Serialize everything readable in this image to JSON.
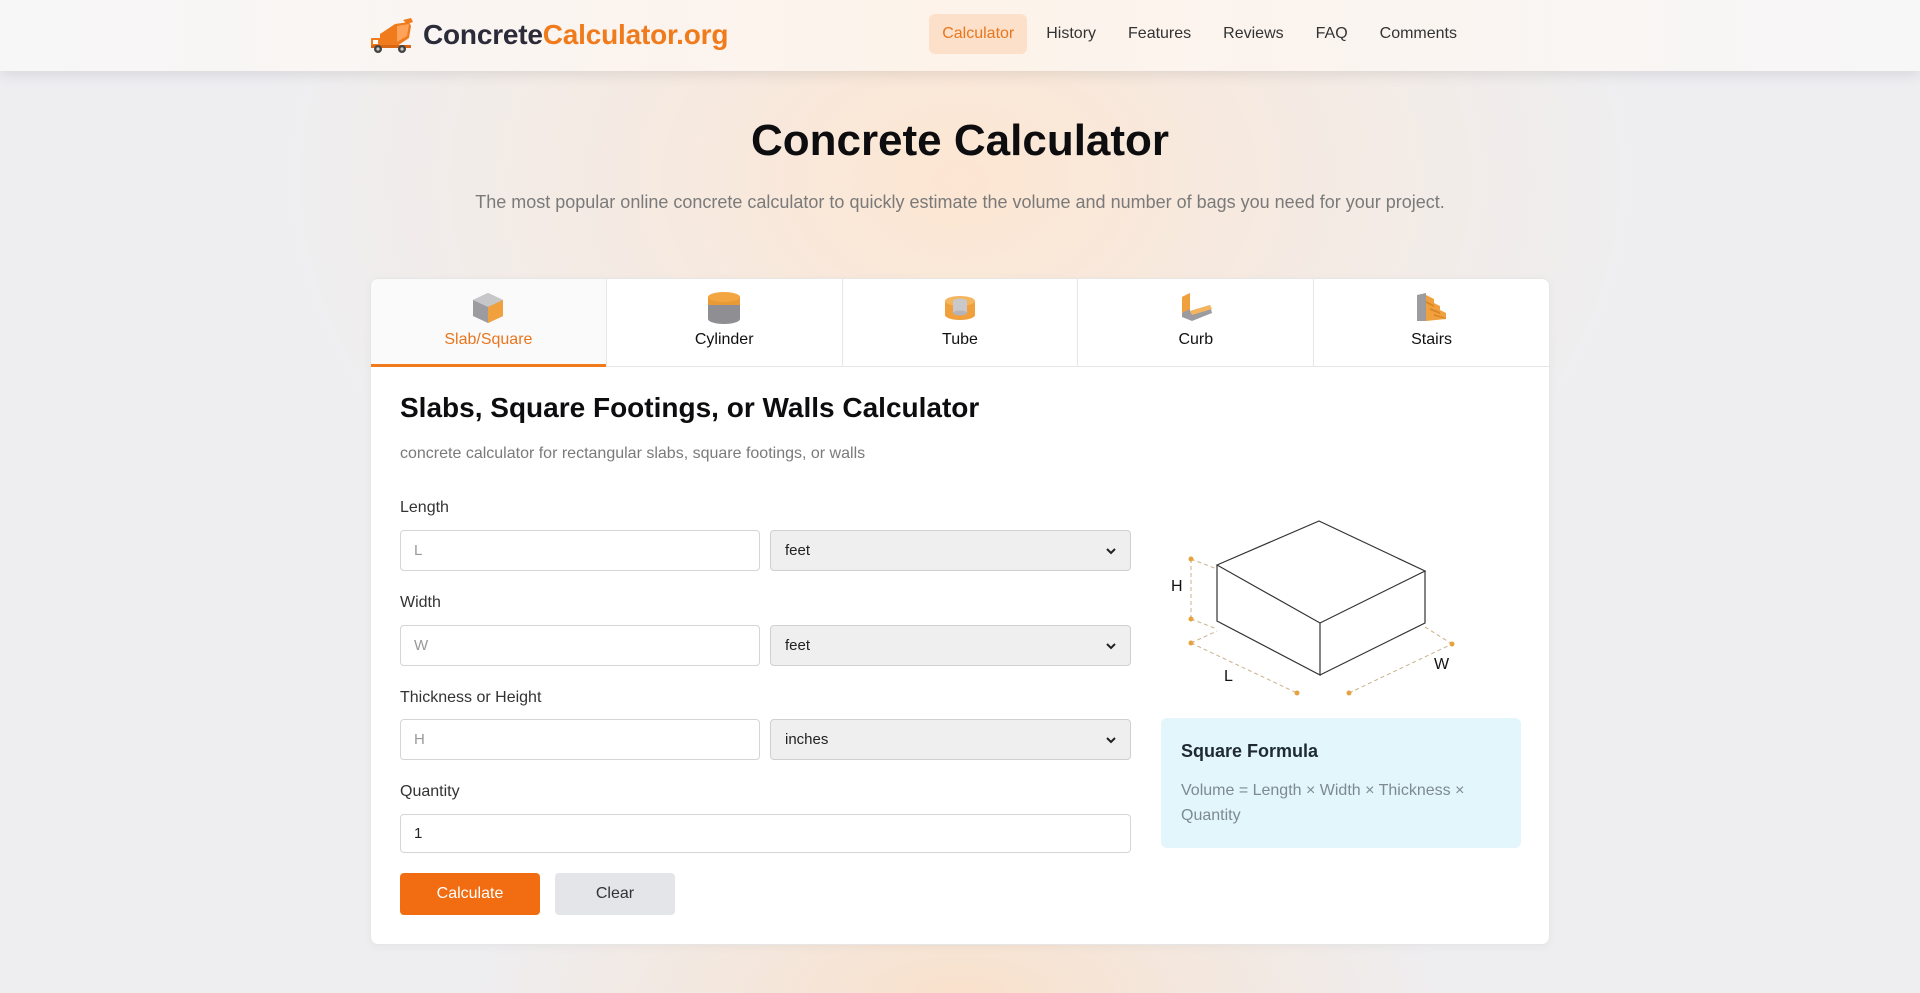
{
  "header": {
    "logo_part1": "Concrete",
    "logo_part2": "Calculator.org",
    "logo_icon": "concrete-mixer-truck-icon",
    "nav": [
      {
        "label": "Calculator",
        "active": true
      },
      {
        "label": "History",
        "active": false
      },
      {
        "label": "Features",
        "active": false
      },
      {
        "label": "Reviews",
        "active": false
      },
      {
        "label": "FAQ",
        "active": false
      },
      {
        "label": "Comments",
        "active": false
      }
    ]
  },
  "hero": {
    "title": "Concrete Calculator",
    "subtitle": "The most popular online concrete calculator to quickly estimate the volume and number of bags you need for your project."
  },
  "tabs": [
    {
      "label": "Slab/Square",
      "icon": "cube-icon",
      "active": true
    },
    {
      "label": "Cylinder",
      "icon": "cylinder-icon",
      "active": false
    },
    {
      "label": "Tube",
      "icon": "tube-icon",
      "active": false
    },
    {
      "label": "Curb",
      "icon": "curb-icon",
      "active": false
    },
    {
      "label": "Stairs",
      "icon": "stairs-icon",
      "active": false
    }
  ],
  "calculator": {
    "title": "Slabs, Square Footings, or Walls Calculator",
    "subtitle": "concrete calculator for rectangular slabs, square footings, or walls",
    "fields": {
      "length": {
        "label": "Length",
        "placeholder": "L",
        "value": "",
        "unit": "feet"
      },
      "width": {
        "label": "Width",
        "placeholder": "W",
        "value": "",
        "unit": "feet"
      },
      "height": {
        "label": "Thickness or Height",
        "placeholder": "H",
        "value": "",
        "unit": "inches"
      },
      "quantity": {
        "label": "Quantity",
        "value": "1"
      }
    },
    "calculate_label": "Calculate",
    "clear_label": "Clear"
  },
  "diagram": {
    "label_h": "H",
    "label_l": "L",
    "label_w": "W"
  },
  "formula": {
    "title": "Square Formula",
    "text": "Volume = Length × Width × Thickness × Quantity"
  },
  "colors": {
    "accent": "#f07b1c",
    "button": "#f26d12",
    "formula_bg": "#e3f6fb"
  }
}
